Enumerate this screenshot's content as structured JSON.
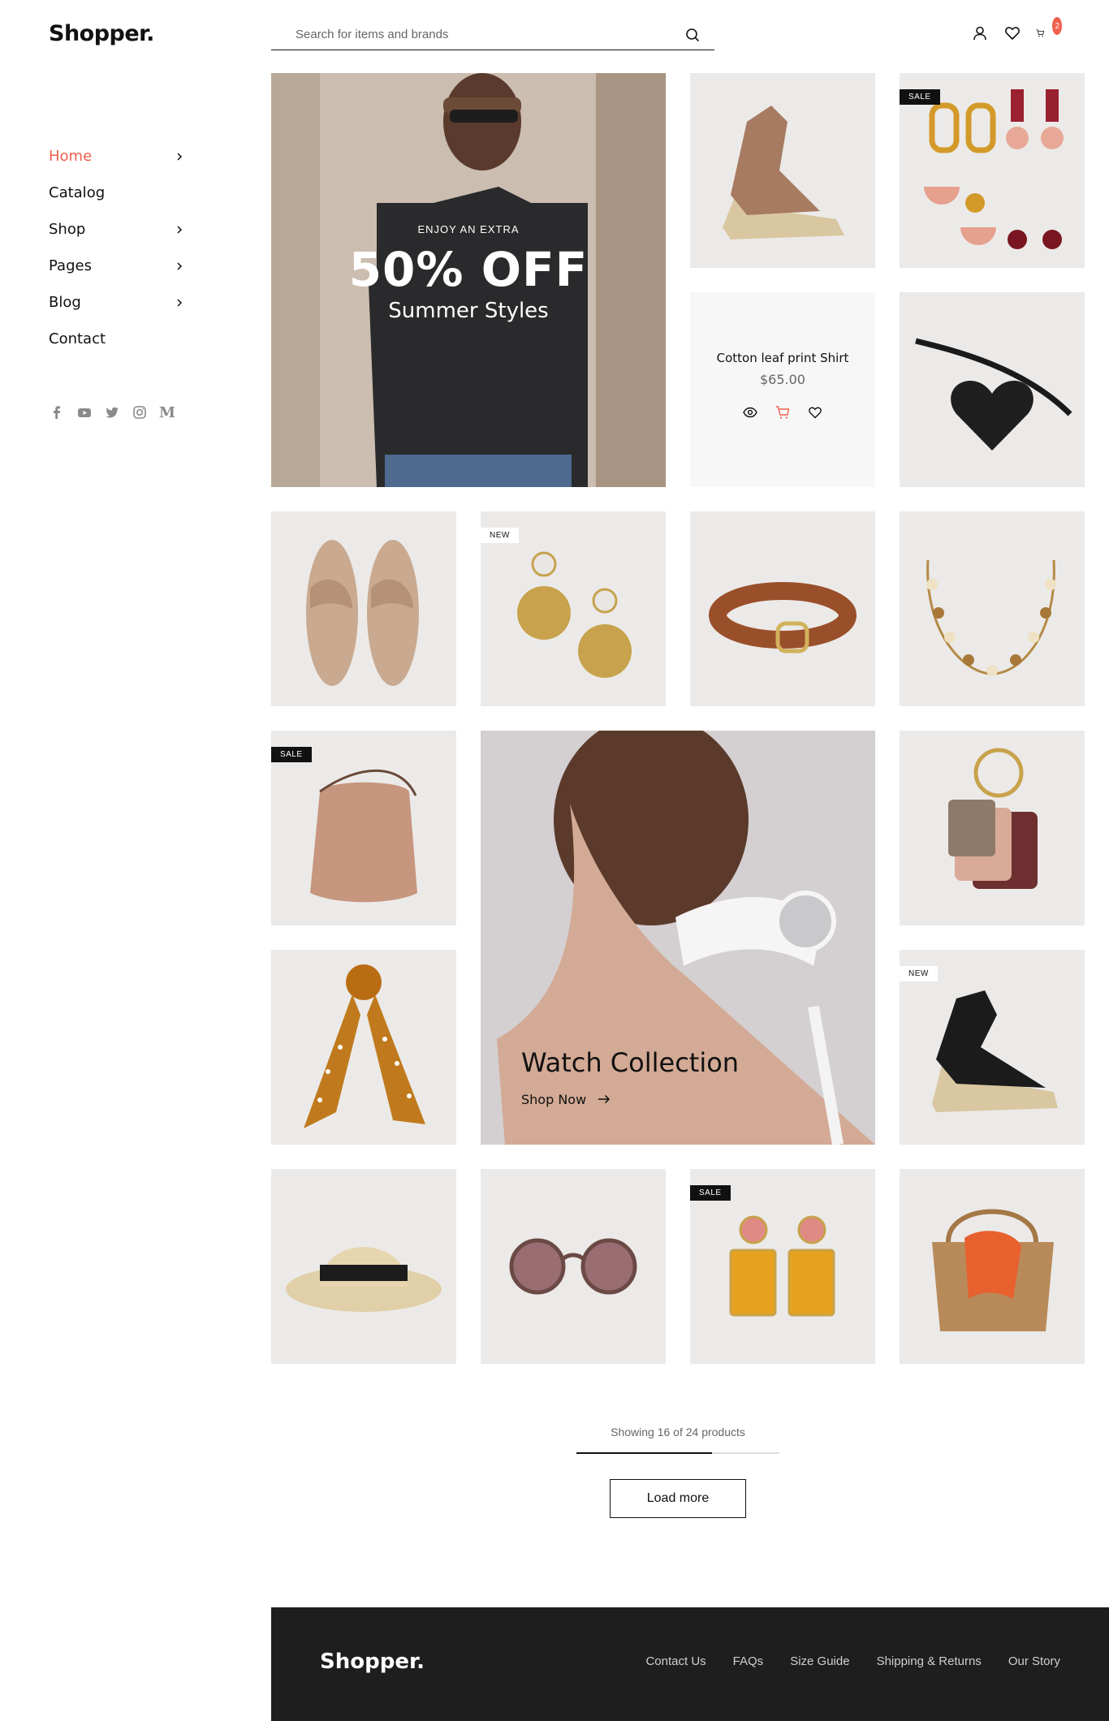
{
  "brand": {
    "logo": "Shopper."
  },
  "sidebar": {
    "items": [
      {
        "label": "Home",
        "active": true,
        "has_submenu": true
      },
      {
        "label": "Catalog",
        "active": false,
        "has_submenu": false
      },
      {
        "label": "Shop",
        "active": false,
        "has_submenu": true
      },
      {
        "label": "Pages",
        "active": false,
        "has_submenu": true
      },
      {
        "label": "Blog",
        "active": false,
        "has_submenu": true
      },
      {
        "label": "Contact",
        "active": false,
        "has_submenu": false
      }
    ],
    "social": [
      "facebook-icon",
      "youtube-icon",
      "twitter-icon",
      "instagram-icon",
      "medium-icon"
    ]
  },
  "header": {
    "search_placeholder": "Search for items and brands",
    "cart_count": "2"
  },
  "hero": {
    "kicker": "ENJOY AN EXTRA",
    "headline": "50% OFF",
    "subline": "Summer Styles"
  },
  "quick_view": {
    "name": "Cotton leaf print Shirt",
    "price": "$65.00"
  },
  "tags": {
    "sale": "SALE",
    "new": "NEW"
  },
  "watch_banner": {
    "title": "Watch Collection",
    "link": "Shop Now"
  },
  "pagination": {
    "showing": "Showing 16 of 24 products",
    "shown": 16,
    "total": 24,
    "load_more": "Load more"
  },
  "footer": {
    "logo": "Shopper.",
    "links": [
      "Contact Us",
      "FAQs",
      "Size Guide",
      "Shipping & Returns",
      "Our Story"
    ]
  },
  "colors": {
    "accent": "#f0604d",
    "footer_bg": "#1e1e1e"
  }
}
